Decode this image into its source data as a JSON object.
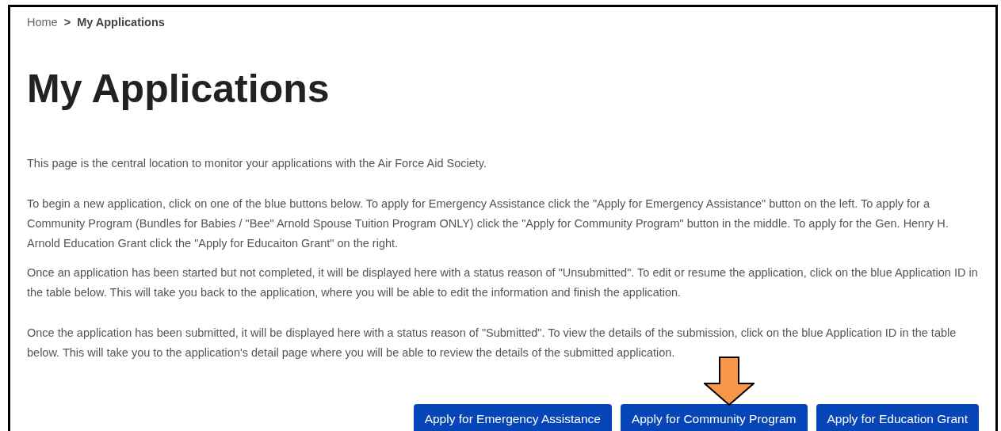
{
  "breadcrumb": [
    {
      "label": "Home",
      "current": false
    },
    {
      "label": "My Applications",
      "current": true
    }
  ],
  "breadcrumb_separator": ">",
  "title": "My Applications",
  "paragraphs": [
    "This page is the central location to monitor your applications with the Air Force Aid Society.",
    "To begin a new application, click on one of the blue buttons below. To apply for Emergency Assistance click the \"Apply for Emergency Assistance\" button on the left. To apply for a Community Program (Bundles for Babies / \"Bee\" Arnold Spouse Tuition Program ONLY) click the \"Apply for Community Program\" button in the middle. To apply for the Gen. Henry H. Arnold Education Grant click the \"Apply for Educaiton Grant\" on the right.",
    "Once an application has been started but not completed, it will be displayed here with a status reason of \"Unsubmitted\". To edit or resume the application, click on the blue Application ID in the table below. This will take you back to the application, where you will be able to edit the information and finish the application.",
    "Once the application has been submitted, it will be displayed here with a status reason of \"Submitted\". To view the details of the submission, click on the blue Application ID in the table below. This will take you to the application's detail page where you will be able to review the details of the submitted application."
  ],
  "buttons": [
    {
      "label": "Apply for Emergency Assistance",
      "highlighted": false
    },
    {
      "label": "Apply for Community Program",
      "highlighted": true
    },
    {
      "label": "Apply for Education Grant",
      "highlighted": false
    }
  ]
}
